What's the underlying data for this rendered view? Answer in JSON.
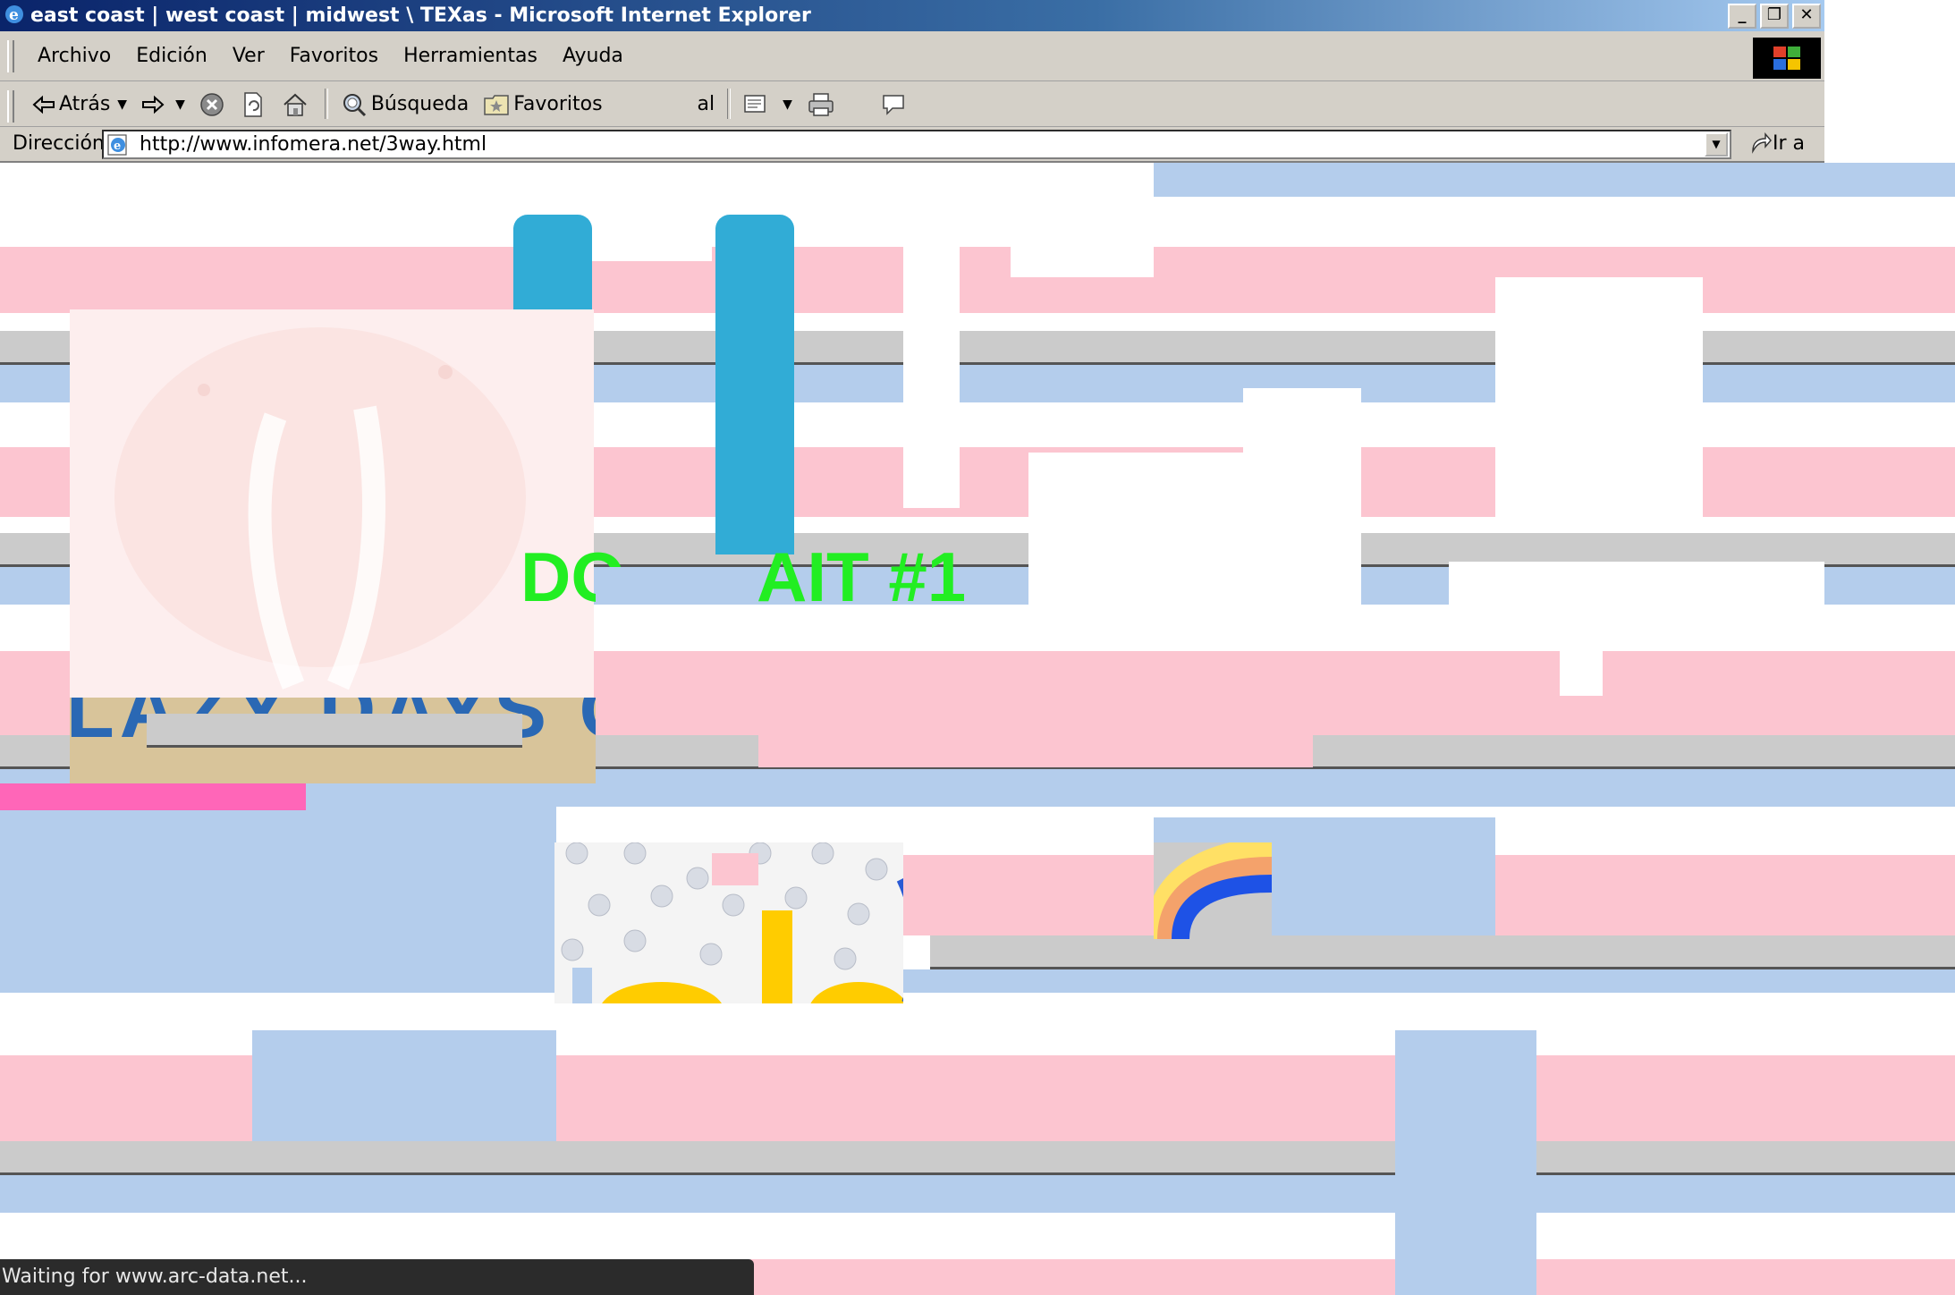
{
  "window": {
    "title": "east coast | west coast | midwest \\ TEXas - Microsoft Internet Explorer",
    "minimize_glyph": "_",
    "restore_glyph": "❐",
    "close_glyph": "✕"
  },
  "menu": {
    "items": [
      "Archivo",
      "Edición",
      "Ver",
      "Favoritos",
      "Herramientas",
      "Ayuda"
    ]
  },
  "toolbar": {
    "back_label": "Atrás",
    "search_label": "Búsqueda",
    "favorites_label": "Favoritos",
    "history_label_fragment": "al"
  },
  "address": {
    "label": "Dirección",
    "url": "http://www.infomera.net/3way.html",
    "go_label": "Ir a"
  },
  "page": {
    "headline_left": "DO",
    "headline_right": "AIT #1",
    "banner_fragment": "LAZY DAYS C"
  },
  "status": {
    "text": "Waiting for www.arc-data.net..."
  },
  "colors": {
    "headline": "#22ee22",
    "title_bar_start": "#0a246a",
    "pink_band": "#fcc5d0",
    "blue_band": "#b4cdec",
    "cyan_bar": "#31acd6",
    "magenta_strip": "#ff66b8"
  }
}
